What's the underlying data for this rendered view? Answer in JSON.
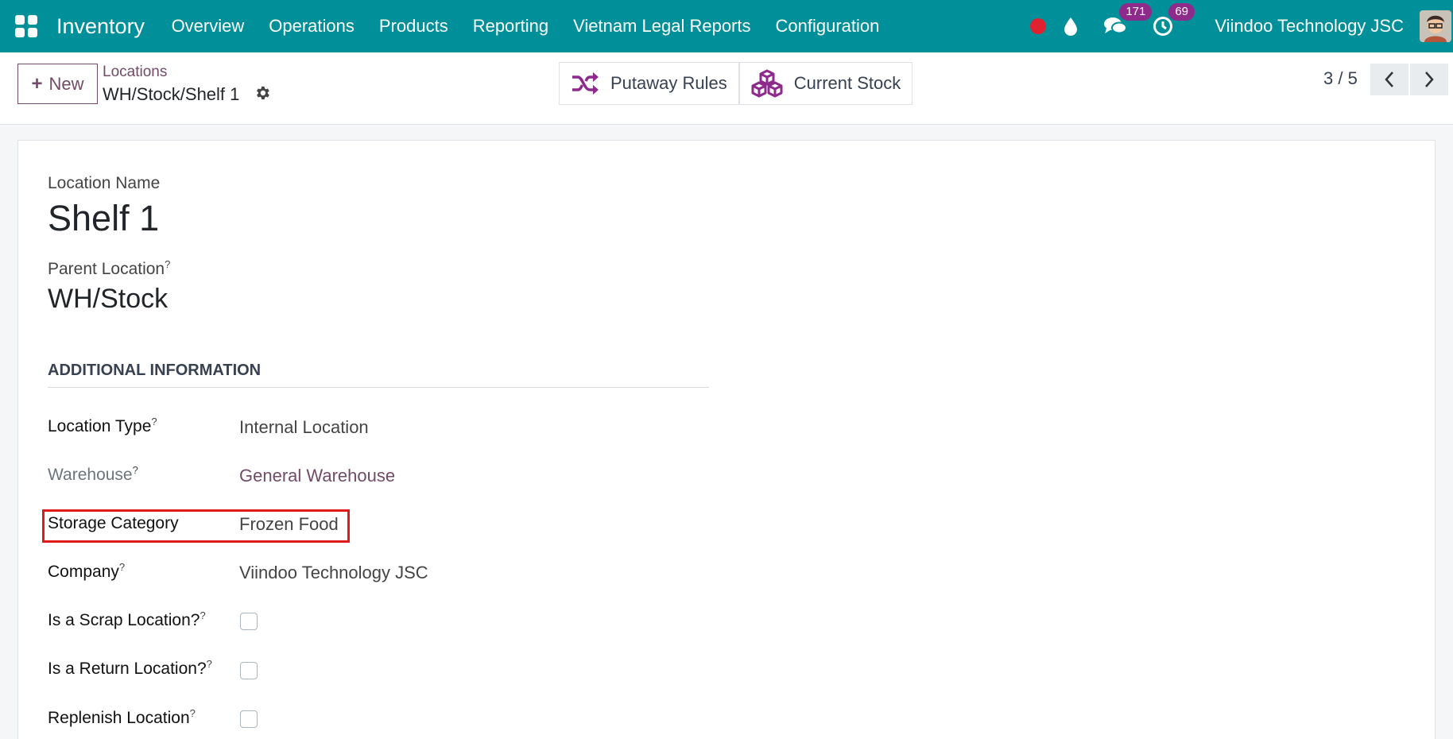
{
  "navbar": {
    "app_name": "Inventory",
    "menu": [
      {
        "label": "Overview"
      },
      {
        "label": "Operations"
      },
      {
        "label": "Products"
      },
      {
        "label": "Reporting"
      },
      {
        "label": "Vietnam Legal Reports"
      },
      {
        "label": "Configuration"
      }
    ],
    "messages_count": "171",
    "activities_count": "69",
    "company": "Viindoo Technology JSC",
    "colors": {
      "bar": "#018f99",
      "badge": "#8e2a8c",
      "record": "#e0212f"
    }
  },
  "control_panel": {
    "new_label": "New",
    "breadcrumb_parent": "Locations",
    "record_title": "WH/Stock/Shelf 1",
    "smart_buttons": [
      {
        "label": "Putaway Rules",
        "icon": "shuffle-icon"
      },
      {
        "label": "Current Stock",
        "icon": "cubes-icon"
      }
    ],
    "pager": "3 / 5"
  },
  "form": {
    "location_name_label": "Location Name",
    "location_name": "Shelf 1",
    "parent_location_label": "Parent Location",
    "parent_location": "WH/Stock",
    "help_mark": "?",
    "section_title": "ADDITIONAL INFORMATION",
    "fields": {
      "location_type": {
        "label": "Location Type",
        "value": "Internal Location"
      },
      "warehouse": {
        "label": "Warehouse",
        "value": "General Warehouse"
      },
      "storage_category": {
        "label": "Storage Category",
        "value": "Frozen Food"
      },
      "company": {
        "label": "Company",
        "value": "Viindoo Technology JSC"
      },
      "scrap": {
        "label": "Is a Scrap Location?",
        "checked": false
      },
      "return": {
        "label": "Is a Return Location?",
        "checked": false
      },
      "replenish": {
        "label": "Replenish Location",
        "checked": false
      }
    }
  }
}
